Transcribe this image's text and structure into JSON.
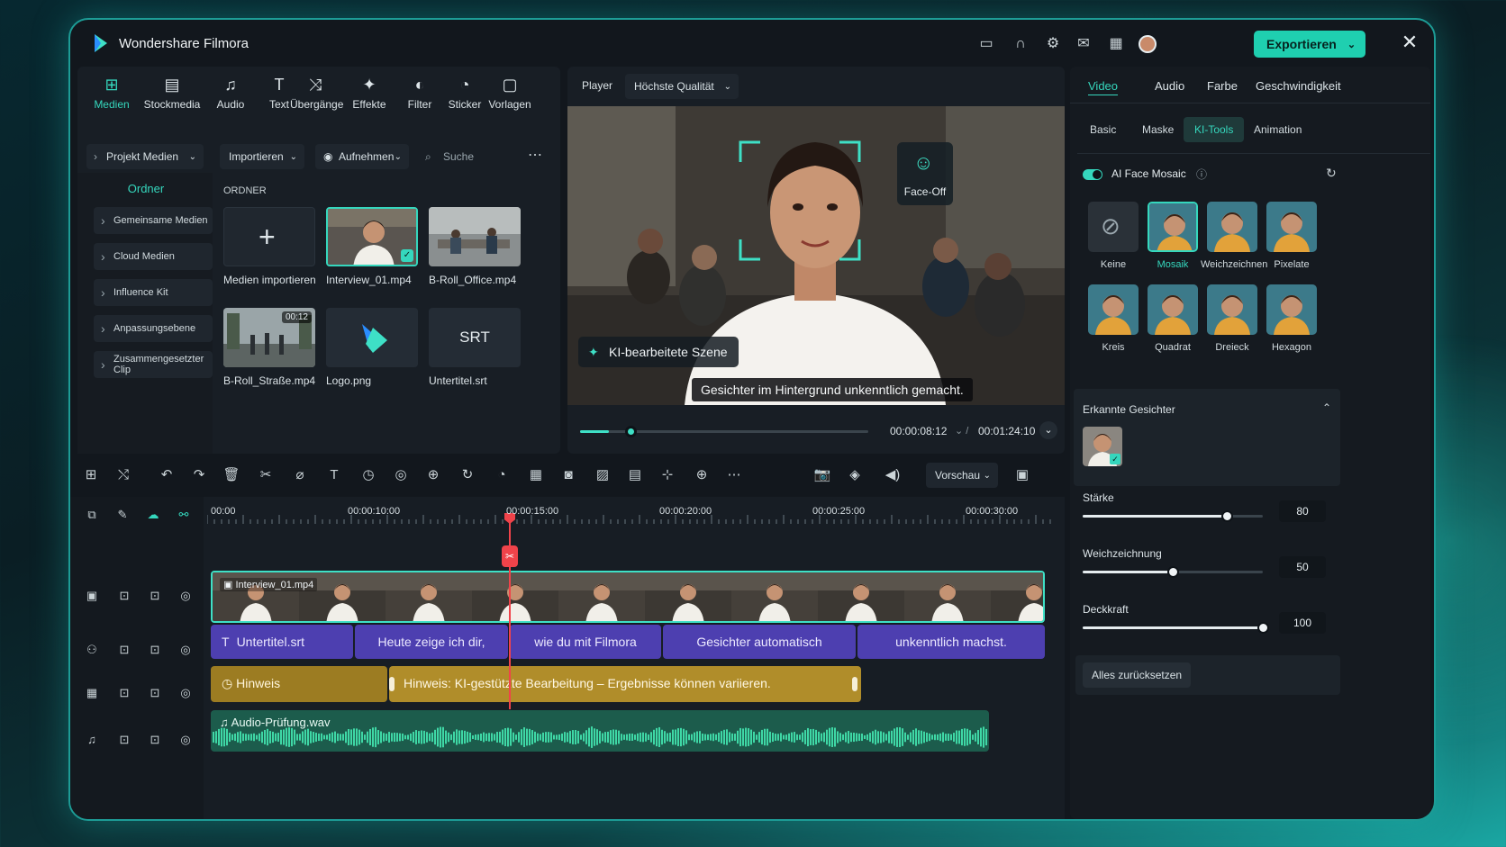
{
  "app": {
    "title": "Wondershare Filmora",
    "export_label": "Exportieren"
  },
  "topnav": [
    {
      "label": "Medien",
      "icon": "media-icon",
      "active": true
    },
    {
      "label": "Stockmedia",
      "icon": "stock-media-icon"
    },
    {
      "label": "Audio",
      "icon": "audio-icon"
    },
    {
      "label": "Text",
      "icon": "text-icon"
    },
    {
      "label": "Übergänge",
      "icon": "transitions-icon"
    },
    {
      "label": "Effekte",
      "icon": "effects-icon"
    },
    {
      "label": "Filter",
      "icon": "filter-icon"
    },
    {
      "label": "Sticker",
      "icon": "sticker-icon"
    },
    {
      "label": "Vorlagen",
      "icon": "templates-icon"
    }
  ],
  "media": {
    "project_label": "Projekt Medien",
    "import_label": "Importieren",
    "record_label": "Aufnehmen",
    "search_placeholder": "Suche",
    "folder_label": "Ordner",
    "folder_header": "ORDNER",
    "sidebar": [
      "Gemeinsame Medien",
      "Cloud Medien",
      "Influence Kit",
      "Anpassungsebene",
      "Zusammengesetzter Clip"
    ],
    "items": [
      {
        "name": "Medien importieren"
      },
      {
        "name": "Interview_01.mp4"
      },
      {
        "name": "B-Roll_Office.mp4"
      },
      {
        "name": "B-Roll_Straße.mp4",
        "duration": "00:12"
      },
      {
        "name": "Logo.png"
      },
      {
        "name": "Untertitel.srt",
        "badge": "SRT"
      }
    ]
  },
  "player": {
    "label": "Player",
    "quality": "Höchste Qualität",
    "faceoff_label": "Face-Off",
    "scene_tag": "KI-bearbeitete Szene",
    "caption": "Gesichter im Hintergrund unkenntlich gemacht.",
    "current_time": "00:00:08:12",
    "total_time": "00:01:24:10",
    "progress": 0.1
  },
  "right": {
    "tabs": [
      "Video",
      "Audio",
      "Farbe",
      "Geschwindigkeit"
    ],
    "subtabs": [
      "Basic",
      "Maske",
      "KI-Tools",
      "Animation"
    ],
    "feature_label": "AI Face Mosaic",
    "effects": [
      "Keine",
      "Mosaik",
      "Weichzeichnen",
      "Pixelate",
      "Kreis",
      "Quadrat",
      "Dreieck",
      "Hexagon"
    ],
    "faces_label": "Erkannte Gesichter",
    "sliders": [
      {
        "label": "Stärke",
        "value": "80",
        "fraction": 0.8
      },
      {
        "label": "Weichzeichnung",
        "value": "50",
        "fraction": 0.5
      },
      {
        "label": "Deckkraft",
        "value": "100",
        "fraction": 1.0
      }
    ],
    "reset_label": "Alles zurücksetzen"
  },
  "timeline": {
    "preview_label": "Vorschau",
    "ruler": [
      "00:00",
      "00:00:10:00",
      "00:00:15:00",
      "00:00:20:00",
      "00:00:25:00",
      "00:00:30:00"
    ],
    "video_clip": "Interview_01.mp4",
    "subtitle_track": [
      "Untertitel.srt",
      "Heute zeige ich dir,",
      "wie du mit Filmora",
      "Gesichter automatisch",
      "unkenntlich machst."
    ],
    "hint_label": "Hinweis",
    "hint_text": "Hinweis: KI-gestützte Bearbeitung – Ergebnisse können variieren.",
    "audio_clip": "Audio-Prüfung.wav"
  },
  "colors": {
    "accent": "#35d7bd",
    "subtitle": "#4d3fb0",
    "hint": "#b08d2a",
    "audio": "#1f8a6a"
  }
}
